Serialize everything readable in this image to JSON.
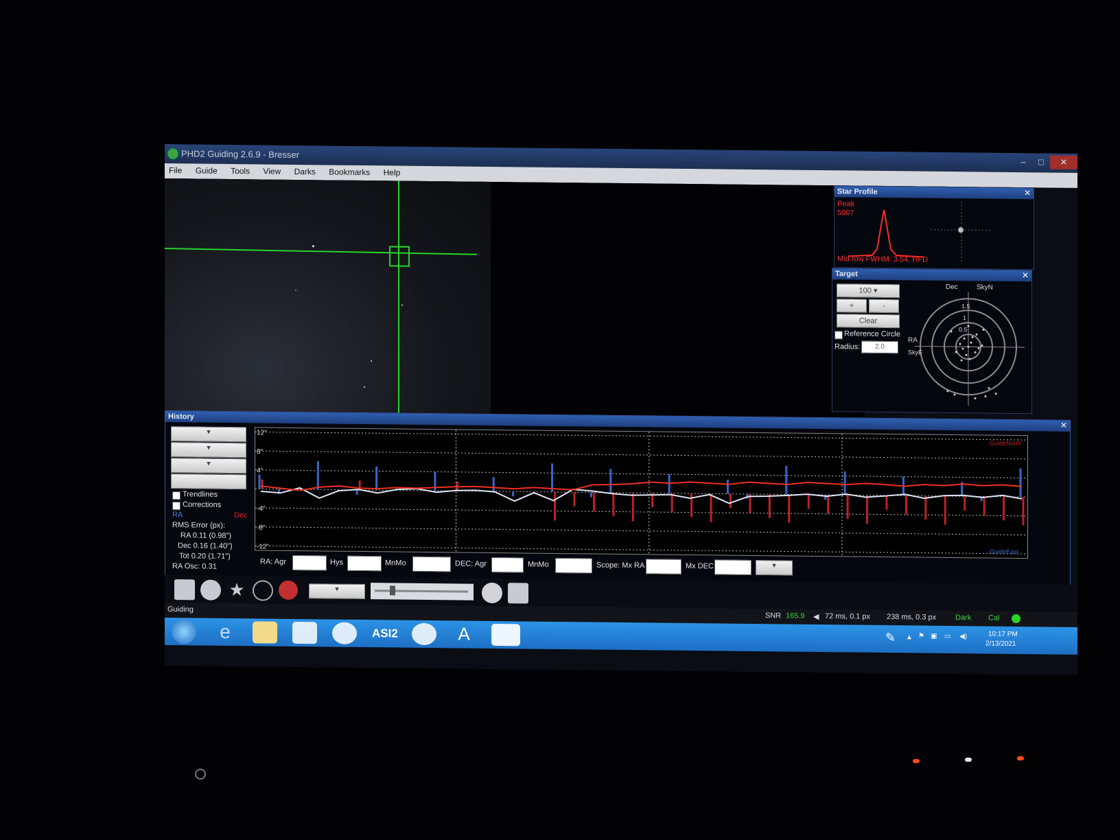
{
  "window": {
    "title": "PHD2 Guiding 2.6.9 - Bresser",
    "minimize": "–",
    "maximize": "□",
    "close": "✕"
  },
  "menu": [
    "File",
    "Guide",
    "Tools",
    "View",
    "Darks",
    "Bookmarks",
    "Help"
  ],
  "star_profile": {
    "title": "Star Profile",
    "peak_label": "Peak",
    "peak_value": "5007",
    "footer": "Mid row FWHM: 3.54, HFD"
  },
  "target": {
    "title": "Target",
    "zoom": "100",
    "plus": "+",
    "minus": "-",
    "clear": "Clear",
    "reference_circle": "Reference Circle",
    "radius_label": "Radius:",
    "radius_value": "2.0",
    "dec_label": "Dec",
    "skyn_label": "SkyN",
    "ra_label": "RA",
    "skye_label": "SkyE",
    "rings": [
      "2",
      "1.5",
      "1",
      "0.5"
    ]
  },
  "history": {
    "title": "History",
    "trendlines": "Trendlines",
    "corrections": "Corrections",
    "ra_legend": "RA",
    "dec_legend": "Dec",
    "rms_title": "RMS Error (px):",
    "rms_ra": "RA 0.11 (0.98\")",
    "rms_dec": "Dec 0.16 (1.40\")",
    "rms_tot": "Tot 0.20 (1.71\")",
    "ra_osc": "RA Osc: 0.31",
    "y_ticks": [
      "12\"",
      "8\"",
      "4\"",
      "-4\"",
      "-8\"",
      "-12\""
    ],
    "top_right": "GuideNorth",
    "bottom_right": "GuideEast",
    "params": {
      "ra_agr": "RA: Agr",
      "hys": "Hys",
      "mnmo1": "MnMo",
      "dec_agr": "DEC: Agr",
      "mnmo2": "MnMo",
      "scope_mx_ra": "Scope: Mx RA",
      "mx_dec": "Mx DEC"
    }
  },
  "status": {
    "state": "Guiding",
    "snr_label": "SNR",
    "snr_value": "165.9",
    "ra_pulse": "72 ms, 0.1 px",
    "dec_pulse": "238 ms, 0.3 px",
    "dark": "Dark",
    "cal": "Cal"
  },
  "taskbar": {
    "time": "10:17 PM",
    "date": "2/13/2021",
    "asi": "ASI2"
  },
  "colors": {
    "ra": "#4a7fe0",
    "dec": "#e02828",
    "reticle": "#25d52a",
    "star": "#9aa6ff"
  },
  "chart_data": {
    "type": "line",
    "title": "",
    "ylabel": "",
    "ylim": [
      -12,
      12
    ],
    "x": [
      0,
      1,
      2,
      3,
      4,
      5,
      6,
      7,
      8,
      9,
      10,
      11,
      12,
      13,
      14,
      15,
      16,
      17,
      18,
      19,
      20,
      21,
      22,
      23,
      24,
      25,
      26,
      27,
      28,
      29,
      30,
      31,
      32,
      33,
      34,
      35,
      36,
      37,
      38,
      39
    ],
    "series": [
      {
        "name": "RA",
        "values": [
          -0.5,
          -0.8,
          0.3,
          -1.8,
          -0.2,
          0.1,
          -0.6,
          0.2,
          0.4,
          -0.3,
          0.1,
          0.2,
          -0.1,
          -2.0,
          -0.2,
          -1.8,
          0.6,
          0.3,
          -0.2,
          -0.5,
          -0.4,
          -0.3,
          -1.0,
          -0.2,
          -2.0,
          -0.5,
          -0.4,
          -0.2,
          0.1,
          -0.3,
          0.2,
          -0.4,
          -0.1,
          0.3,
          -0.5,
          0.1,
          0.2,
          -0.2,
          0.3,
          -0.4
        ]
      },
      {
        "name": "Dec",
        "values": [
          0.6,
          0.2,
          -0.2,
          0.5,
          0.8,
          0.4,
          0.3,
          0.6,
          0.5,
          0.7,
          0.9,
          1.0,
          0.8,
          0.6,
          0.9,
          0.7,
          0.5,
          1.6,
          1.7,
          1.9,
          2.3,
          2.1,
          2.4,
          2.2,
          2.0,
          2.5,
          2.3,
          2.1,
          2.6,
          2.4,
          2.2,
          2.5,
          2.3,
          2.0,
          2.4,
          2.2,
          2.6,
          2.3,
          2.5,
          2.2
        ]
      }
    ]
  }
}
